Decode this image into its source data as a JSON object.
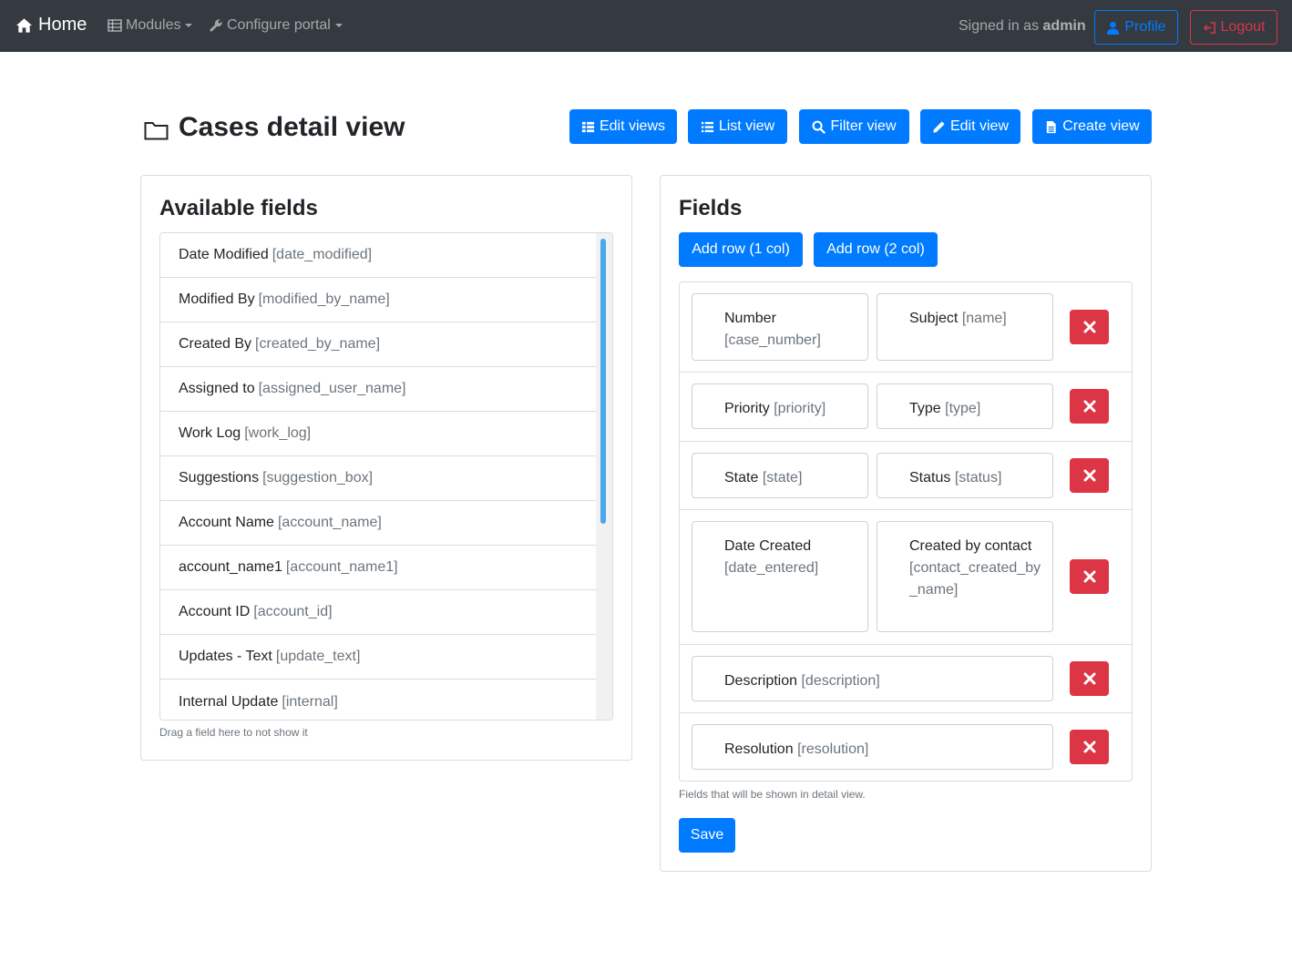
{
  "navbar": {
    "home_label": "Home",
    "modules_label": "Modules",
    "configure_label": "Configure portal",
    "signed_in_prefix": "Signed in as",
    "signed_in_user": "admin",
    "profile_label": "Profile",
    "logout_label": "Logout"
  },
  "page": {
    "title": "Cases detail view",
    "buttons": {
      "edit_views": "Edit views",
      "list_view": "List view",
      "filter_view": "Filter view",
      "edit_view": "Edit view",
      "create_view": "Create view"
    }
  },
  "available": {
    "heading": "Available fields",
    "items": [
      {
        "label": "Date Modified",
        "key": "[date_modified]"
      },
      {
        "label": "Modified By",
        "key": "[modified_by_name]"
      },
      {
        "label": "Created By",
        "key": "[created_by_name]"
      },
      {
        "label": "Assigned to",
        "key": "[assigned_user_name]"
      },
      {
        "label": "Work Log",
        "key": "[work_log]"
      },
      {
        "label": "Suggestions",
        "key": "[suggestion_box]"
      },
      {
        "label": "Account Name",
        "key": "[account_name]"
      },
      {
        "label": "account_name1",
        "key": "[account_name1]"
      },
      {
        "label": "Account ID",
        "key": "[account_id]"
      },
      {
        "label": "Updates - Text",
        "key": "[update_text]"
      },
      {
        "label": "Internal Update",
        "key": "[internal]"
      }
    ],
    "help": "Drag a field here to not show it"
  },
  "fields": {
    "heading": "Fields",
    "add_row_1": "Add row (1 col)",
    "add_row_2": "Add row (2 col)",
    "rows": [
      [
        {
          "label": "Number",
          "key": "[case_number]"
        },
        {
          "label": "Subject",
          "key": "[name]"
        }
      ],
      [
        {
          "label": "Priority",
          "key": "[priority]"
        },
        {
          "label": "Type",
          "key": "[type]"
        }
      ],
      [
        {
          "label": "State",
          "key": "[state]"
        },
        {
          "label": "Status",
          "key": "[status]"
        }
      ],
      [
        {
          "label": "Date Created",
          "key": "[date_entered]"
        },
        {
          "label": "Created by contact",
          "key": "[contact_created_by_name]"
        }
      ],
      [
        {
          "label": "Description",
          "key": "[description]"
        }
      ],
      [
        {
          "label": "Resolution",
          "key": "[resolution]"
        }
      ]
    ],
    "help": "Fields that will be shown in detail view.",
    "save_label": "Save"
  },
  "colors": {
    "navbar_bg": "#343a40",
    "primary": "#007bff",
    "danger": "#dc3545",
    "muted": "#6c757d"
  },
  "icons": [
    "home-icon",
    "table-icon",
    "wrench-icon",
    "user-icon",
    "logout-icon",
    "folder-icon",
    "th-list-icon",
    "list-icon",
    "search-icon",
    "pencil-icon",
    "file-icon",
    "close-icon"
  ]
}
